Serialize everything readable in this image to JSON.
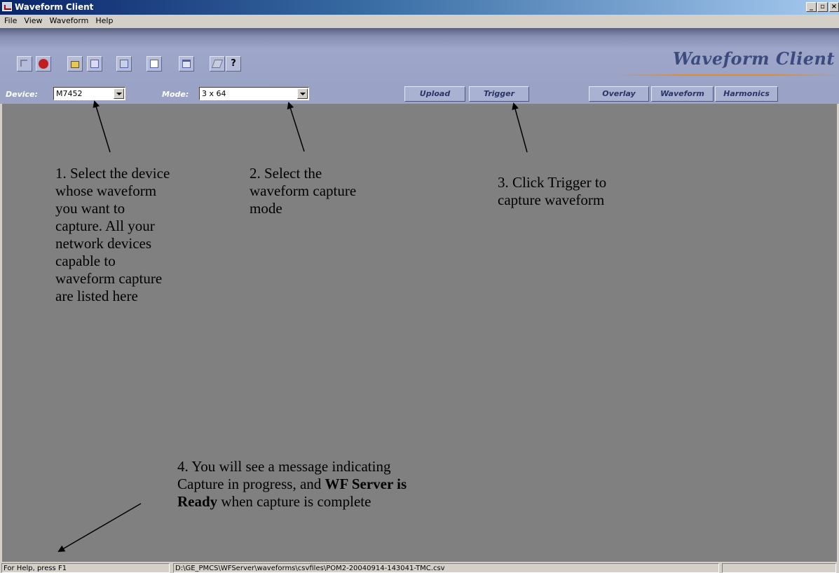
{
  "window": {
    "title": "Waveform Client",
    "minimize": "_",
    "maximize": "▫",
    "close": "×"
  },
  "menu": [
    "File",
    "View",
    "Waveform",
    "Help"
  ],
  "toolbar": {
    "brand": "Waveform Client",
    "icons": [
      "exit-icon",
      "stop-icon",
      "open-folder-icon",
      "copy-icon",
      "pages-icon",
      "chart-icon",
      "window-icon",
      "print-icon",
      "help-icon"
    ]
  },
  "controls": {
    "device_label": "Device:",
    "device_value": "M7452",
    "mode_label": "Mode:",
    "mode_value": "3 x 64",
    "buttons": [
      "Upload",
      "Trigger",
      "Overlay",
      "Waveform",
      "Harmonics"
    ]
  },
  "annotations": {
    "step1": [
      "1. Select the device",
      "whose waveform",
      "you want to",
      "capture. All your",
      "network devices",
      "capable to",
      "waveform capture",
      "are listed here"
    ],
    "step2": [
      "2. Select the",
      "waveform capture",
      "mode"
    ],
    "step3": [
      "3. Click Trigger to",
      "capture waveform"
    ],
    "step4_line1": "4. You will see a message indicating",
    "step4_line2a": "Capture in progress, and ",
    "step4_line2b": "WF Server is",
    "step4_line3a": "Ready",
    "step4_line3b": " when capture is complete"
  },
  "status": {
    "help": "For Help, press F1",
    "path": "D:\\GE_PMCS\\WFServer\\waveforms\\csvfiles\\POM2-20040914-143041-TMC.csv",
    "extra": ""
  },
  "colors": {
    "main_bg": "#808080",
    "toolbar_bg": "#9aa3c6",
    "button_text": "#2a3468"
  }
}
